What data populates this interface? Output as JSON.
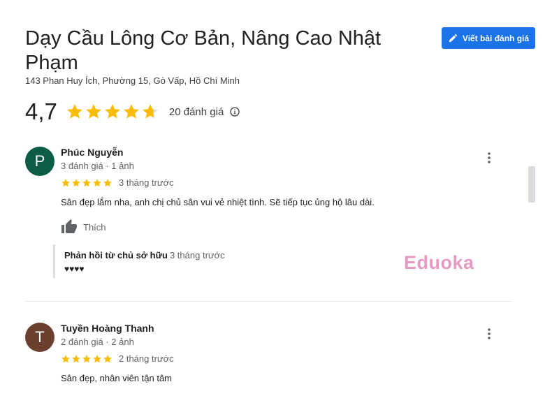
{
  "place": {
    "name": "Dạy Cầu Lông Cơ Bản, Nâng Cao Nhật Phạm",
    "address": "143 Phan Huy Ích, Phường 15, Gò Vấp, Hồ Chí Minh"
  },
  "header": {
    "write_review_label": "Viết bài đánh giá",
    "brand_color": "#1a73e8"
  },
  "summary": {
    "rating": "4,7",
    "rating_value": 4.7,
    "review_count": "20 đánh giá",
    "star_color": "#fbbc04"
  },
  "reviews": [
    {
      "avatar_letter": "P",
      "avatar_color": "#0b5d45",
      "name": "Phúc Nguyễn",
      "meta": "3 đánh giá · 1 ảnh",
      "stars": 5,
      "time": "3 tháng trước",
      "text": "Sân đẹp lắm nha, anh chị chủ sân vui vẻ nhiệt tình. Sẽ tiếp tục ủng hộ lâu dài.",
      "like_label": "Thích",
      "owner_reply": {
        "label": "Phản hồi từ chủ sở hữu",
        "time": "3 tháng trước",
        "text": "♥♥♥♥"
      }
    },
    {
      "avatar_letter": "T",
      "avatar_color": "#6b3f2e",
      "name": "Tuyền Hoàng Thanh",
      "meta": "2 đánh giá · 2 ảnh",
      "stars": 5,
      "time": "2 tháng trước",
      "text": "Sân đẹp, nhân viên tận tâm"
    }
  ],
  "watermark": "Eduoka",
  "icons": {
    "write": "pencil-icon",
    "info": "info-icon",
    "more": "more-vert-icon",
    "like": "thumb-up-icon",
    "star": "star-icon"
  }
}
